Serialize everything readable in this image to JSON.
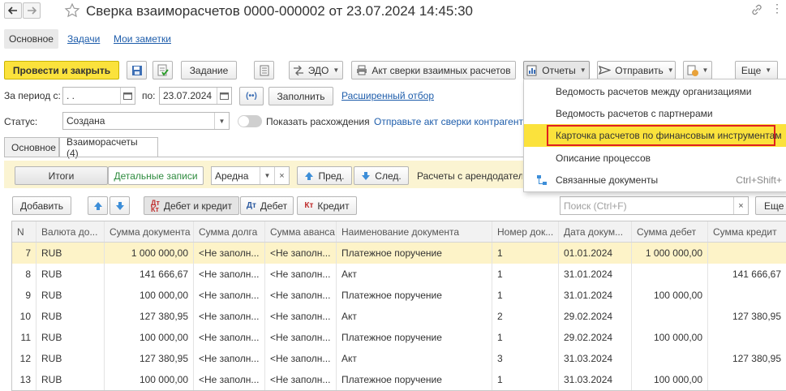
{
  "window": {
    "title": "Сверка взаиморасчетов 0000-000002 от 23.07.2024 14:45:30"
  },
  "sections": {
    "main": "Основное",
    "tasks": "Задачи",
    "notes": "Мои заметки"
  },
  "toolbar": {
    "post_close": "Провести и закрыть",
    "task": "Задание",
    "edo": "ЭДО",
    "act": "Акт сверки взаимных расчетов",
    "reports": "Отчеты",
    "send": "Отправить",
    "more": "Еще",
    "help": "?"
  },
  "period": {
    "label": "За период с:",
    "from_value": " .  .",
    "to_label": "по:",
    "to_value": "23.07.2024",
    "fill": "Заполнить",
    "advanced": "Расширенный отбор"
  },
  "status": {
    "label": "Статус:",
    "value": "Создана",
    "toggle_label": "Показать расхождения",
    "send_link": "Отправьте акт сверки контрагенту"
  },
  "tabs": [
    {
      "label": "Основное"
    },
    {
      "label": "Взаиморасчеты (4)"
    }
  ],
  "filter_bar": {
    "totals": "Итоги",
    "details": "Детальные записи",
    "select_value": "Аредна",
    "prev": "Пред.",
    "next": "След.",
    "info": "Расчеты с арендодателем"
  },
  "table_toolbar": {
    "add": "Добавить",
    "debit_credit": "Дебет и кредит",
    "debit": "Дебет",
    "credit": "Кредит",
    "search_placeholder": "Поиск (Ctrl+F)",
    "more": "Еще"
  },
  "menu": {
    "items": [
      {
        "label": "Ведомость расчетов между организациями",
        "shortcut": ""
      },
      {
        "label": "Ведомость расчетов с партнерами",
        "shortcut": ""
      },
      {
        "label": "Карточка расчетов по финансовым инструментам",
        "shortcut": ""
      },
      {
        "label": "Описание процессов",
        "shortcut": ""
      },
      {
        "label": "Связанные документы",
        "shortcut": "Ctrl+Shift+"
      }
    ]
  },
  "table": {
    "columns": [
      "N",
      "Валюта до...",
      "Сумма документа",
      "Сумма долга",
      "Сумма аванса",
      "Наименование документа",
      "Номер док...",
      "Дата докум...",
      "Сумма дебет",
      "Сумма кредит"
    ],
    "rows": [
      [
        "7",
        "RUB",
        "1 000 000,00",
        "<Не заполн...",
        "<Не заполн...",
        "Платежное поручение",
        "1",
        "01.01.2024",
        "1 000 000,00",
        ""
      ],
      [
        "8",
        "RUB",
        "141 666,67",
        "<Не заполн...",
        "<Не заполн...",
        "Акт",
        "1",
        "31.01.2024",
        "",
        "141 666,67"
      ],
      [
        "9",
        "RUB",
        "100 000,00",
        "<Не заполн...",
        "<Не заполн...",
        "Платежное поручение",
        "1",
        "31.01.2024",
        "100 000,00",
        ""
      ],
      [
        "10",
        "RUB",
        "127 380,95",
        "<Не заполн...",
        "<Не заполн...",
        "Акт",
        "2",
        "29.02.2024",
        "",
        "127 380,95"
      ],
      [
        "11",
        "RUB",
        "100 000,00",
        "<Не заполн...",
        "<Не заполн...",
        "Платежное поручение",
        "1",
        "29.02.2024",
        "100 000,00",
        ""
      ],
      [
        "12",
        "RUB",
        "127 380,95",
        "<Не заполн...",
        "<Не заполн...",
        "Акт",
        "3",
        "31.03.2024",
        "",
        "127 380,95"
      ],
      [
        "13",
        "RUB",
        "100 000,00",
        "<Не заполн...",
        "<Не заполн...",
        "Платежное поручение",
        "1",
        "31.03.2024",
        "100 000,00",
        ""
      ]
    ],
    "selected_row": 0
  },
  "colors": {
    "accent_yellow": "#fbe23c",
    "selected_row": "#fdf3c8",
    "link": "#1e5dab",
    "highlight_border": "#e02020"
  }
}
